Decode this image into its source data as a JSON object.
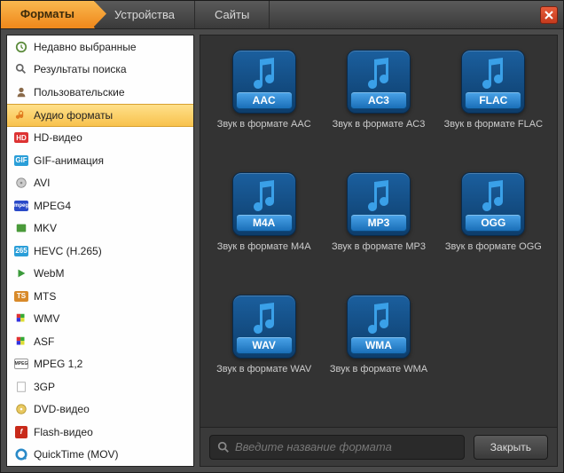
{
  "tabs": [
    {
      "label": "Форматы",
      "active": true
    },
    {
      "label": "Устройства",
      "active": false
    },
    {
      "label": "Сайты",
      "active": false
    }
  ],
  "sidebar": {
    "items": [
      {
        "label": "Недавно выбранные",
        "icon": "clock"
      },
      {
        "label": "Результаты поиска",
        "icon": "search"
      },
      {
        "label": "Пользовательские",
        "icon": "user"
      },
      {
        "label": "Аудио форматы",
        "icon": "audio",
        "selected": true
      },
      {
        "label": "HD-видео",
        "icon": "hd"
      },
      {
        "label": "GIF-анимация",
        "icon": "gif"
      },
      {
        "label": "AVI",
        "icon": "disc"
      },
      {
        "label": "MPEG4",
        "icon": "mpeg"
      },
      {
        "label": "MKV",
        "icon": "mkv"
      },
      {
        "label": "HEVC (H.265)",
        "icon": "265"
      },
      {
        "label": "WebM",
        "icon": "play"
      },
      {
        "label": "MTS",
        "icon": "ts"
      },
      {
        "label": "WMV",
        "icon": "flag"
      },
      {
        "label": "ASF",
        "icon": "flag"
      },
      {
        "label": "MPEG 1,2",
        "icon": "mpeg12"
      },
      {
        "label": "3GP",
        "icon": "blank"
      },
      {
        "label": "DVD-видео",
        "icon": "dvd"
      },
      {
        "label": "Flash-видео",
        "icon": "flash"
      },
      {
        "label": "QuickTime (MOV)",
        "icon": "qt"
      }
    ]
  },
  "formats": [
    {
      "code": "AAC",
      "label": "Звук в формате AAC"
    },
    {
      "code": "AC3",
      "label": "Звук в формате AC3"
    },
    {
      "code": "FLAC",
      "label": "Звук в формате FLAC"
    },
    {
      "code": "M4A",
      "label": "Звук в формате M4A"
    },
    {
      "code": "MP3",
      "label": "Звук в формате MP3"
    },
    {
      "code": "OGG",
      "label": "Звук в формате OGG"
    },
    {
      "code": "WAV",
      "label": "Звук в формате WAV"
    },
    {
      "code": "WMA",
      "label": "Звук в формате WMA"
    }
  ],
  "search": {
    "placeholder": "Введите название формата"
  },
  "footer": {
    "close_label": "Закрыть"
  },
  "icons": {
    "hd_text": "HD",
    "gif_text": "GIF",
    "mpeg_text": "mpeg",
    "n265_text": "265",
    "ts_text": "TS",
    "mpeg12_text": "MPEG"
  },
  "colors": {
    "accent": "#f08a1d",
    "tile": "#1a6fb8"
  }
}
